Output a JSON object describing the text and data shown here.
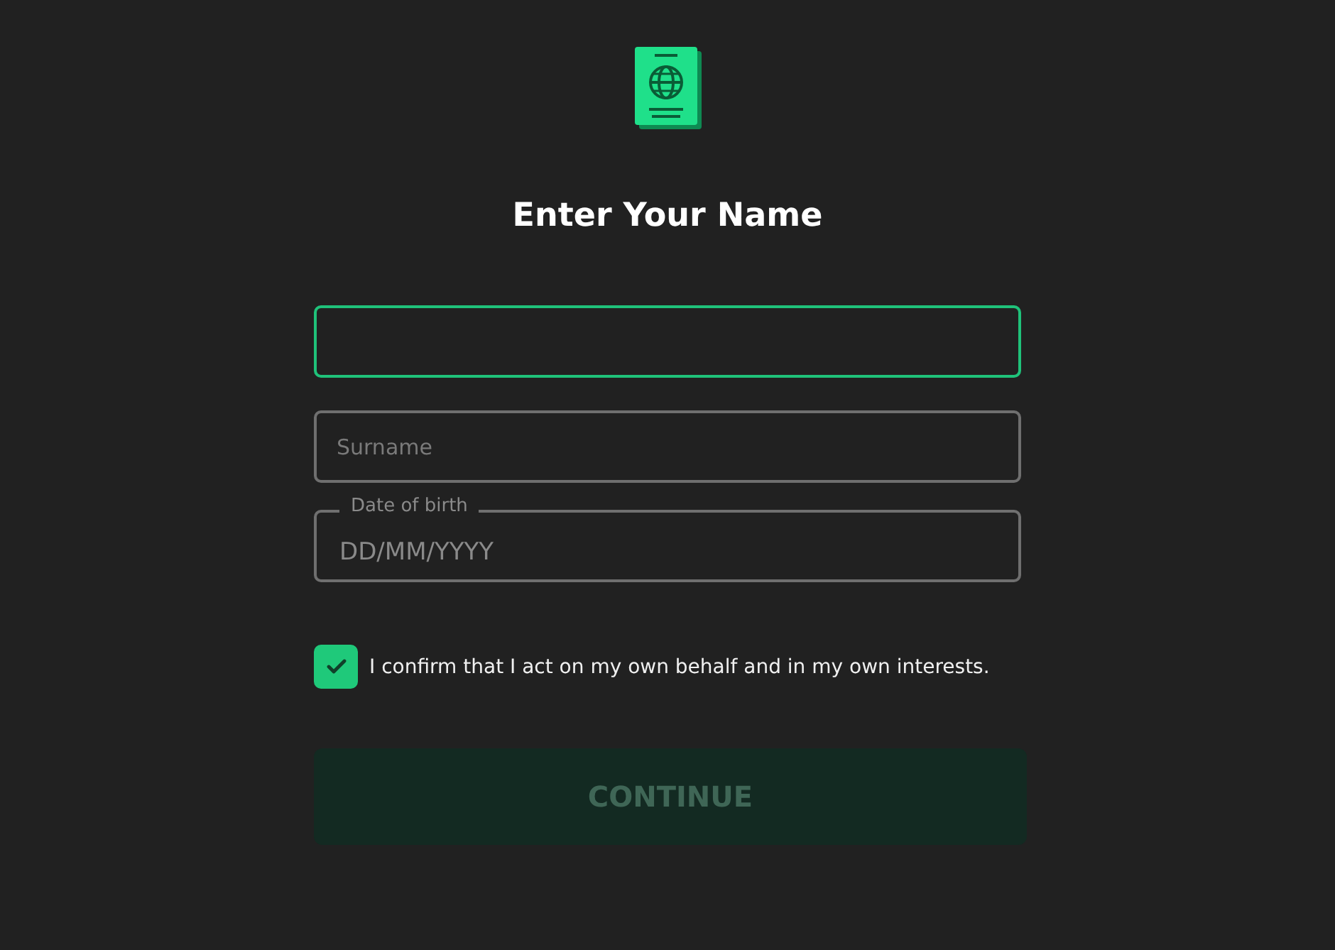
{
  "title": "Enter Your Name",
  "fields": [
    {
      "kind": "plain",
      "focused": true
    },
    {
      "kind": "plain",
      "placeholder": "Surname",
      "focused": false
    },
    {
      "kind": "legend",
      "label": "Date of birth",
      "placeholder": "DD/MM/YYYY",
      "focused": false
    }
  ],
  "consent": {
    "checked": true,
    "text": "I confirm that I act on my own behalf and in my own interests."
  },
  "button": {
    "label": "CONTINUE",
    "disabled": true
  }
}
